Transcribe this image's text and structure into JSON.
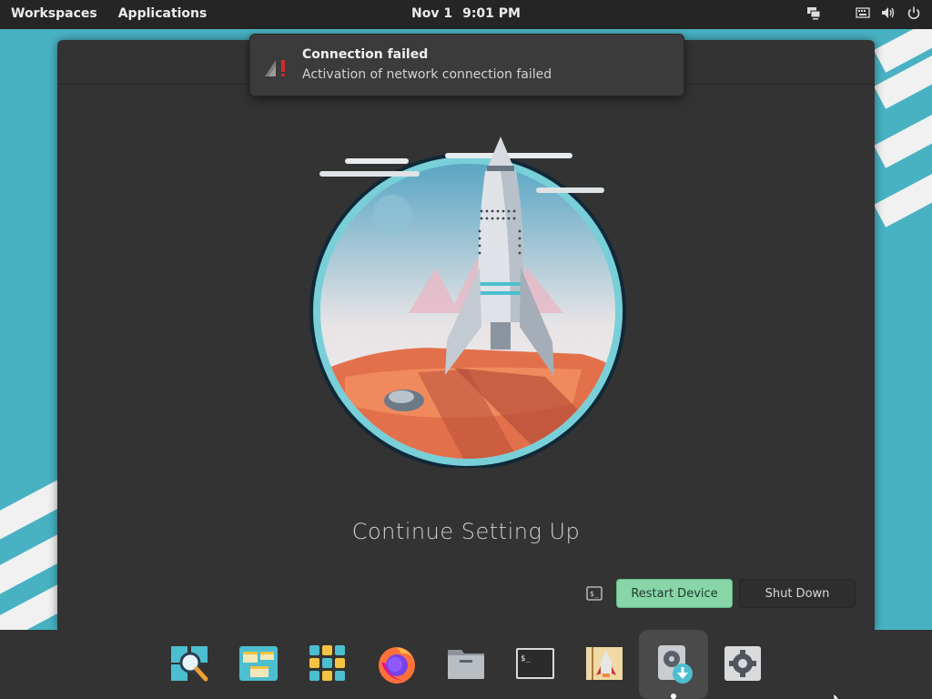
{
  "top_panel": {
    "workspaces_label": "Workspaces",
    "applications_label": "Applications",
    "date": "Nov 1",
    "time": "9:01 PM",
    "tray_icons": [
      "network-icon",
      "keyboard-icon",
      "volume-icon",
      "power-icon"
    ]
  },
  "notification": {
    "title": "Connection failed",
    "body": "Activation of network connection failed",
    "icon": "network-error-icon"
  },
  "window": {
    "headline": "Continue Setting Up",
    "restart_label": "Restart Device",
    "shutdown_label": "Shut Down",
    "terminal_icon": "terminal-icon"
  },
  "dock": {
    "items": [
      "search-icon",
      "multitasking-icon",
      "applications-grid-icon",
      "firefox-icon",
      "files-icon",
      "terminal-icon",
      "launcher-icon",
      "installer-icon",
      "settings-icon"
    ],
    "active_item": "installer-icon"
  },
  "colors": {
    "wallpaper": "#48b2c3",
    "panel": "#252525",
    "window": "#333333",
    "restart_button": "#88d6a8",
    "accent_teal": "#4bbfd0"
  }
}
